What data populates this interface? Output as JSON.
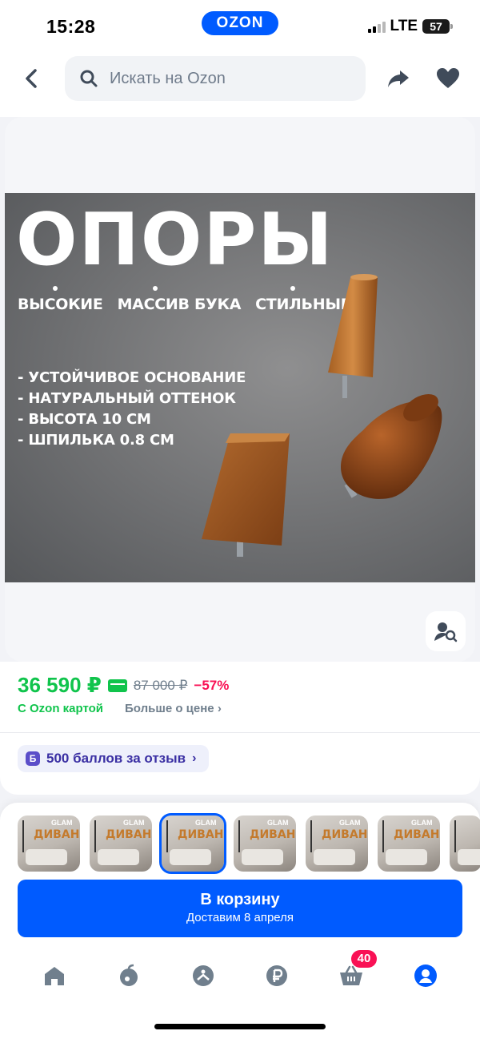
{
  "status_bar": {
    "time": "15:28",
    "brand": "OZON",
    "network": "LTE",
    "battery": "57"
  },
  "header": {
    "search_placeholder": "Искать на Ozon",
    "icons": [
      "back-arrow-icon",
      "search-icon",
      "share-icon",
      "heart-icon"
    ]
  },
  "product_image": {
    "headline": "ОПОРЫ",
    "tags": [
      "ВЫСОКИЕ",
      "МАССИВ БУКА",
      "СТИЛЬНЫЕ"
    ],
    "features": [
      "- УСТОЙЧИВОЕ ОСНОВАНИЕ",
      "- НАТУРАЛЬНЫЙ ОТТЕНОК",
      "- ВЫСОТА 10 СМ",
      "- ШПИЛЬКА 0.8 СМ"
    ]
  },
  "price": {
    "current": "36 590 ₽",
    "old": "87 000 ₽",
    "discount": "−57%",
    "ozon_card_label": "С Ozon картой",
    "more_label": "Больше о цене",
    "accent_color": "#10c44c",
    "discount_color": "#f91155"
  },
  "bonus": {
    "badge": "Б",
    "label": "500 баллов за отзыв"
  },
  "variants": {
    "count_visible": 7,
    "selected_index": 2,
    "thumb_word": "ДИВАН",
    "thumb_label": "GLAM"
  },
  "cart_button": {
    "label": "В корзину",
    "delivery": "Доставим 8 апреля",
    "color": "#005bff"
  },
  "tab_bar": {
    "items": [
      "home-icon",
      "fresh-icon",
      "catalog-icon",
      "finance-icon",
      "cart-icon",
      "profile-icon"
    ],
    "cart_badge": "40",
    "active": "profile-icon"
  }
}
